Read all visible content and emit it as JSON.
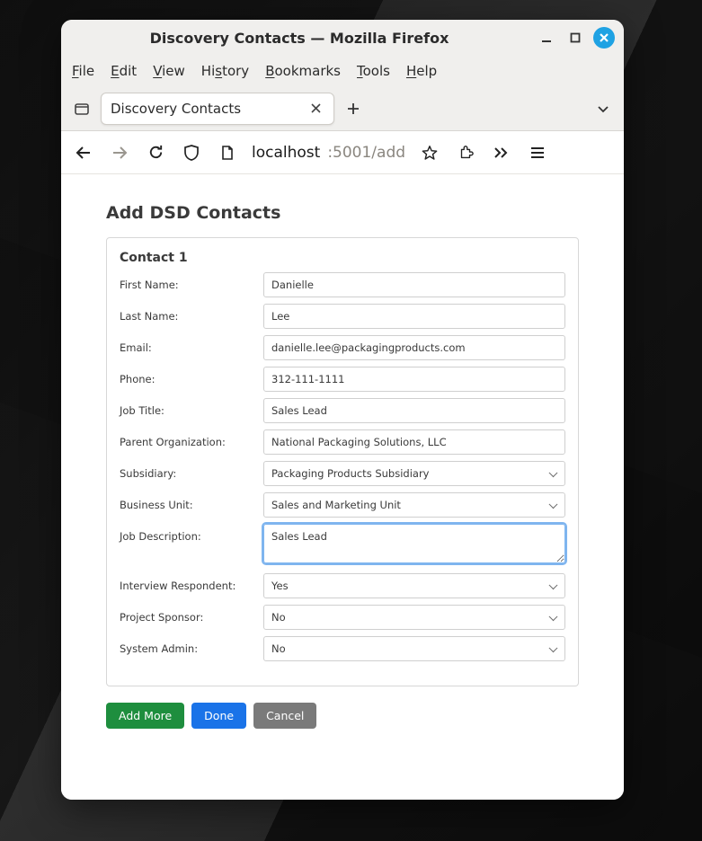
{
  "window": {
    "title": "Discovery Contacts — Mozilla Firefox"
  },
  "menubar": {
    "file": "File",
    "edit": "Edit",
    "view": "View",
    "history": "History",
    "bookmarks": "Bookmarks",
    "tools": "Tools",
    "help": "Help"
  },
  "tabs": {
    "active": {
      "label": "Discovery Contacts"
    }
  },
  "url": {
    "host": "localhost",
    "path": ":5001/add"
  },
  "page": {
    "title": "Add DSD Contacts",
    "card_header": "Contact 1",
    "labels": {
      "first_name": "First Name:",
      "last_name": "Last Name:",
      "email": "Email:",
      "phone": "Phone:",
      "job_title": "Job Title:",
      "parent_org": "Parent Organization:",
      "subsidiary": "Subsidiary:",
      "business_unit": "Business Unit:",
      "job_description": "Job Description:",
      "interview_respondent": "Interview Respondent:",
      "project_sponsor": "Project Sponsor:",
      "system_admin": "System Admin:"
    },
    "values": {
      "first_name": "Danielle",
      "last_name": "Lee",
      "email": "danielle.lee@packagingproducts.com",
      "phone": "312-111-1111",
      "job_title": "Sales Lead",
      "parent_org": "National Packaging Solutions, LLC",
      "subsidiary": "Packaging Products Subsidiary",
      "business_unit": "Sales and Marketing Unit",
      "job_description": "Sales Lead",
      "interview_respondent": "Yes",
      "project_sponsor": "No",
      "system_admin": "No"
    },
    "buttons": {
      "add_more": "Add More",
      "done": "Done",
      "cancel": "Cancel"
    }
  }
}
